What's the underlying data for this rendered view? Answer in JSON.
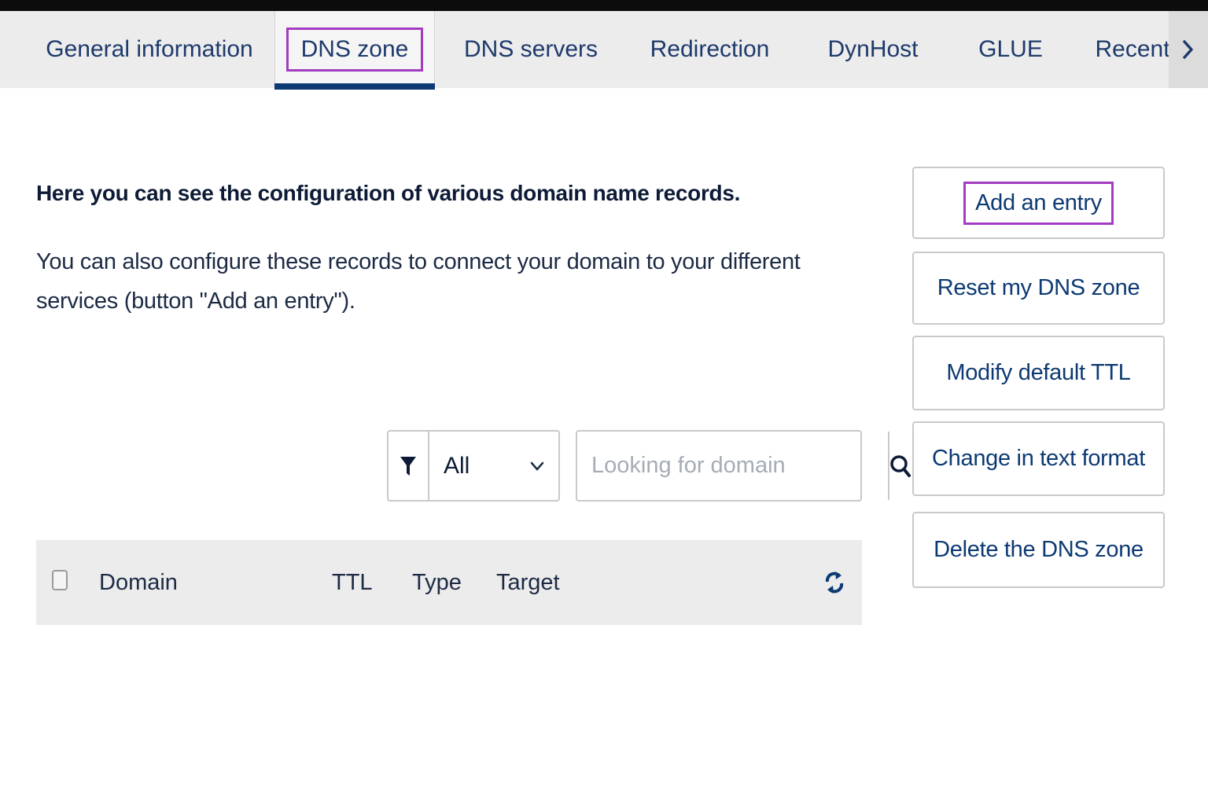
{
  "tabs": [
    {
      "label": "General information",
      "active": false
    },
    {
      "label": "DNS zone",
      "active": true
    },
    {
      "label": "DNS servers",
      "active": false
    },
    {
      "label": "Redirection",
      "active": false
    },
    {
      "label": "DynHost",
      "active": false
    },
    {
      "label": "GLUE",
      "active": false
    },
    {
      "label": "Recent",
      "active": false
    }
  ],
  "tab_scroll_icon": "chevron-right-icon",
  "intro": {
    "heading": "Here you can see the configuration of various domain name records.",
    "body": "You can also configure these records to connect your domain to your different services (button \"Add an entry\")."
  },
  "filter": {
    "icon": "filter-icon",
    "selected": "All"
  },
  "search": {
    "placeholder": "Looking for domain",
    "value": "",
    "icon": "search-icon"
  },
  "table": {
    "columns": [
      "Domain",
      "TTL",
      "Type",
      "Target"
    ],
    "refresh_icon": "refresh-icon"
  },
  "actions": [
    {
      "label": "Add an entry",
      "highlighted": true
    },
    {
      "label": "Reset my DNS zone",
      "highlighted": false
    },
    {
      "label": "Modify default TTL",
      "highlighted": false
    },
    {
      "label": "Change in text format",
      "highlighted": false
    },
    {
      "label": "Delete the DNS zone",
      "highlighted": false
    }
  ],
  "colors": {
    "primary": "#0d3a73",
    "highlight": "#a33cc2",
    "tab_bar_bg": "#ececec"
  }
}
